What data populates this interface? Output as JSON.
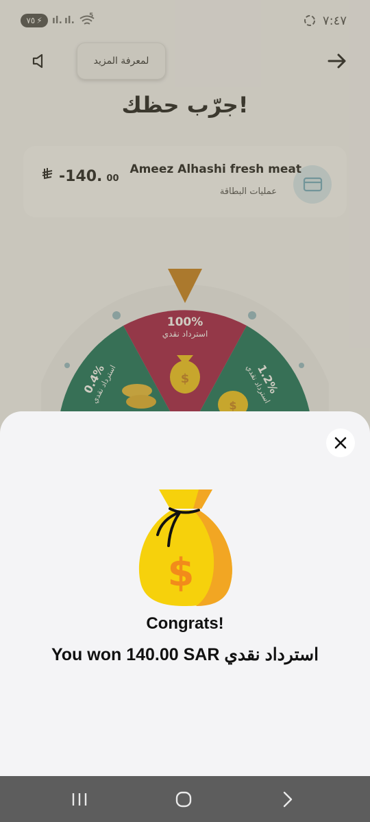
{
  "status_bar": {
    "battery": "٧٥",
    "time": "٧:٤٧",
    "signal_1": "ıl.",
    "signal_2": "ıl.",
    "wifi_badge": "5"
  },
  "header": {
    "learn_more_label": "لمعرفة المزيد",
    "title": "جرّب حظك!"
  },
  "transaction": {
    "merchant": "Ameez Alhashi fresh meat",
    "type": "عمليات البطاقة",
    "amount_main": "-140.",
    "amount_cents": "00",
    "currency_symbol": "⃁"
  },
  "wheel": {
    "segments": [
      {
        "percent": "100%",
        "label": "استرداد نقدي",
        "color": "#a0113a"
      },
      {
        "percent": "1.2%",
        "label": "استرداد نقدي",
        "color": "#0b6b52"
      },
      {
        "percent": "0.4%",
        "label": "استرداد نقدي",
        "color": "#0b6b52"
      }
    ],
    "pointer_color": "#c57a10"
  },
  "result_sheet": {
    "congrats": "Congrats!",
    "won_message": "You won 140.00 SAR استرداد نقدي",
    "icon": "money-bag-icon"
  },
  "nav_bar": {
    "items": [
      "recent-apps-icon",
      "home-icon",
      "back-icon"
    ]
  },
  "colors": {
    "sheet_bg": "#f4f4f6",
    "bag_yellow": "#f6d10c",
    "bag_orange": "#f2a623",
    "dollar": "#f28b1b"
  }
}
